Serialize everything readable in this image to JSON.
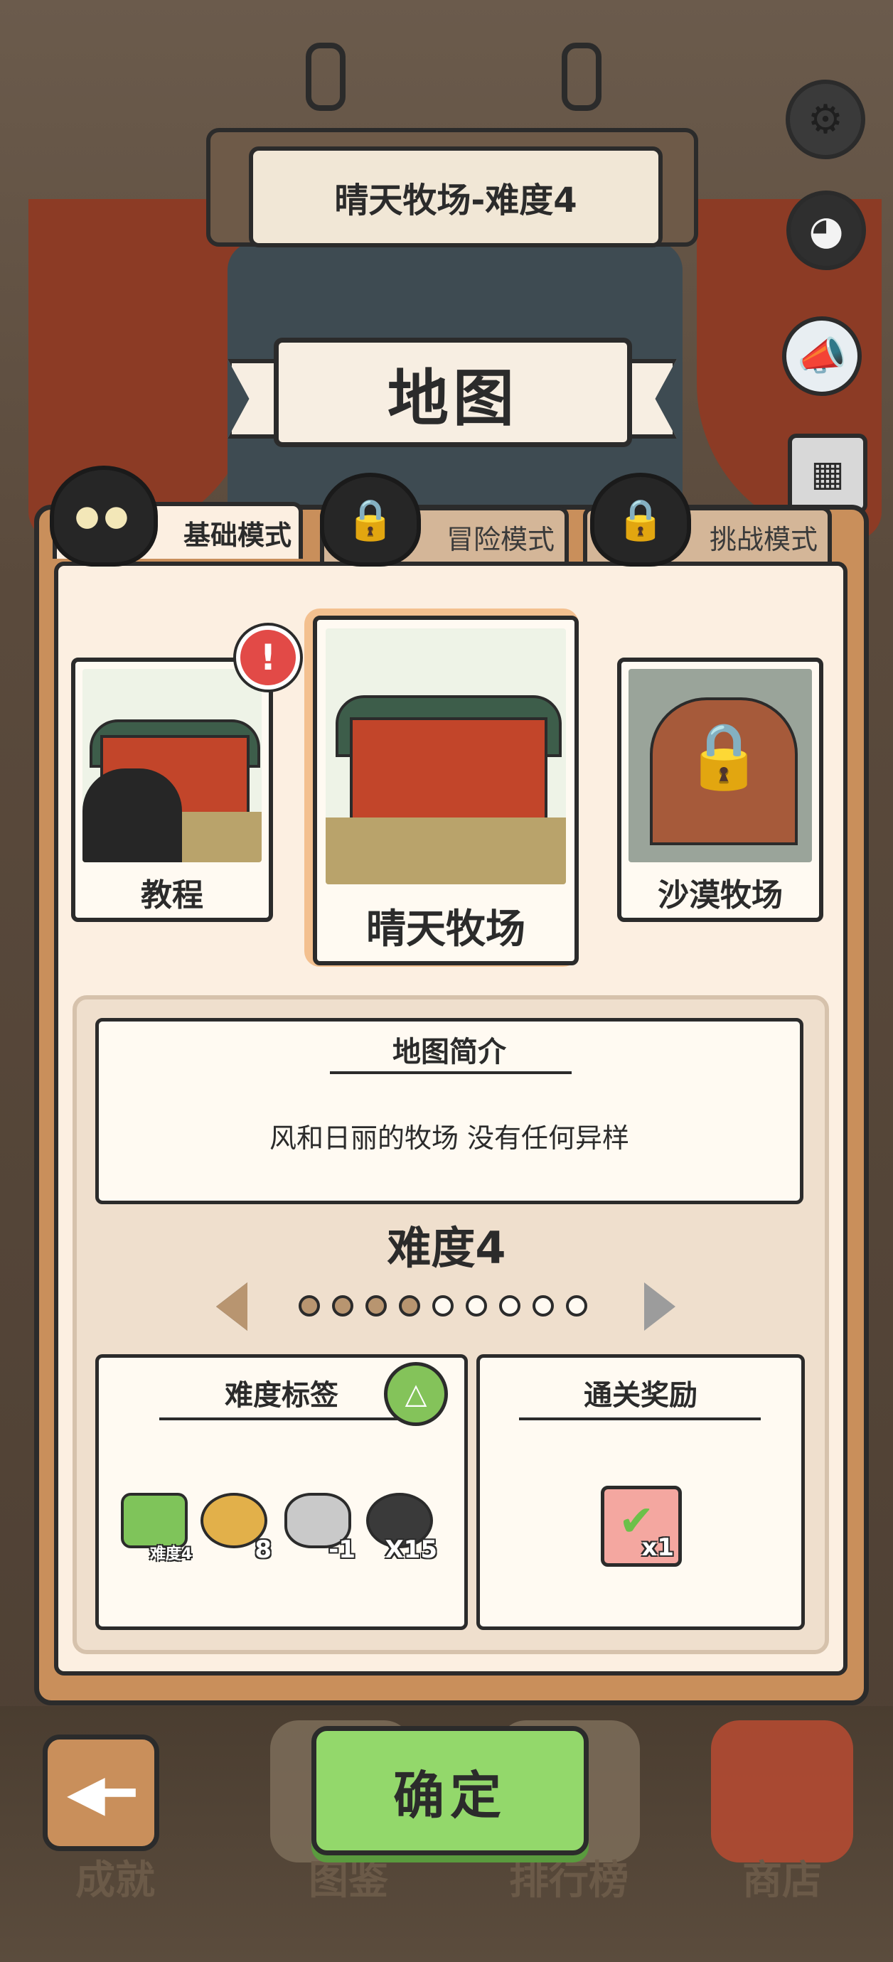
{
  "header": {
    "title_sign": "晴天牧场-难度4",
    "ribbon_title": "地图"
  },
  "side_icons": [
    "gear-icon",
    "penguin-avatar-icon",
    "megaphone-icon",
    "calendar-icon"
  ],
  "tabs": [
    {
      "label": "基础模式",
      "active": true,
      "locked": false
    },
    {
      "label": "冒险模式",
      "active": false,
      "locked": true
    },
    {
      "label": "挑战模式",
      "active": false,
      "locked": true
    }
  ],
  "maps": [
    {
      "name": "教程",
      "selected": false,
      "locked": false,
      "has_alert": true,
      "alert": "!"
    },
    {
      "name": "晴天牧场",
      "selected": true,
      "locked": false
    },
    {
      "name": "沙漠牧场",
      "selected": false,
      "locked": true
    }
  ],
  "description": {
    "title": "地图简介",
    "text": "风和日丽的牧场 没有任何异样"
  },
  "difficulty": {
    "label": "难度4",
    "current": 4,
    "total": 9
  },
  "tags": {
    "title": "难度标签",
    "items": [
      {
        "icon": "difficulty-arrow-icon",
        "value": "难度4"
      },
      {
        "icon": "paw-flag-icon",
        "value": "8"
      },
      {
        "icon": "tin-can-icon",
        "value": "-1"
      },
      {
        "icon": "masked-creature-icon",
        "value": "X15"
      }
    ]
  },
  "reward": {
    "title": "通关奖励",
    "icon": "checked-card-icon",
    "count": "x1"
  },
  "bottom_nav": {
    "back_icon": "back-arrow-icon",
    "confirm": "确定",
    "items": [
      "成就",
      "图鉴",
      "排行榜",
      "商店"
    ]
  },
  "colors": {
    "panel": "#c98f5b",
    "panel_inner": "#fcefe1",
    "confirm_green": "#93d86b",
    "alert_red": "#e24a47",
    "dot_filled": "#b89570"
  }
}
